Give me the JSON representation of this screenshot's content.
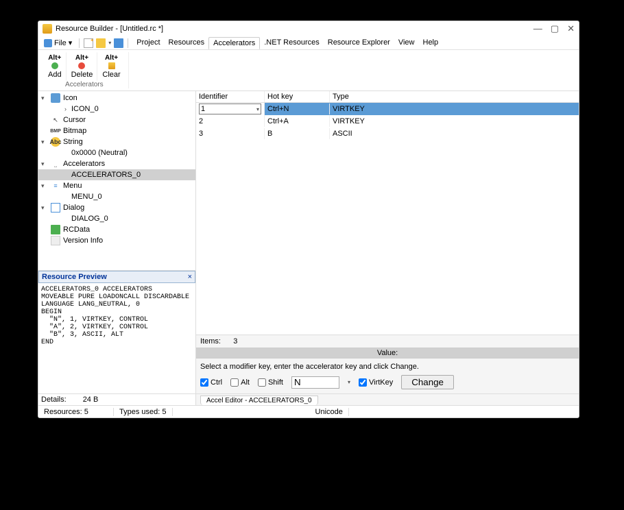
{
  "title": "Resource Builder - [Untitled.rc *]",
  "windowControls": {
    "min": "—",
    "max": "▢",
    "close": "✕"
  },
  "file": {
    "label": "File",
    "arrow": "▾"
  },
  "topMenu": [
    "Project",
    "Resources",
    "Accelerators",
    ".NET Resources",
    "Resource Explorer",
    "View",
    "Help"
  ],
  "activeTopMenuIndex": 2,
  "ribbon": {
    "group": "Accelerators",
    "buttons": [
      {
        "keycap": "Alt+",
        "label": "Add"
      },
      {
        "keycap": "Alt+",
        "label": "Delete"
      },
      {
        "keycap": "Alt+",
        "label": "Clear"
      }
    ]
  },
  "tree": [
    {
      "expander": "▾",
      "icon": "icon",
      "label": "Icon"
    },
    {
      "child": true,
      "expander": "›",
      "label": "ICON_0"
    },
    {
      "icon": "cursor",
      "glyph": "↖",
      "label": "Cursor"
    },
    {
      "icon": "bmp",
      "glyph": "BMP",
      "label": "Bitmap"
    },
    {
      "expander": "▾",
      "icon": "string",
      "glyph": "Abc",
      "label": "String"
    },
    {
      "child": true,
      "label": "0x0000 (Neutral)"
    },
    {
      "expander": "▾",
      "icon": "accel",
      "glyph": "⎵",
      "label": "Accelerators"
    },
    {
      "child": true,
      "selected": true,
      "label": "ACCELERATORS_0"
    },
    {
      "expander": "▾",
      "icon": "menu",
      "glyph": "≡",
      "label": "Menu"
    },
    {
      "child": true,
      "label": "MENU_0"
    },
    {
      "expander": "▾",
      "icon": "dialog",
      "label": "Dialog"
    },
    {
      "child": true,
      "label": "DIALOG_0"
    },
    {
      "icon": "rcdata",
      "glyph": "",
      "label": "RCData"
    },
    {
      "icon": "ver",
      "glyph": "",
      "label": "Version Info"
    }
  ],
  "preview": {
    "title": "Resource Preview",
    "body": "ACCELERATORS_0 ACCELERATORS\nMOVEABLE PURE LOADONCALL DISCARDABLE\nLANGUAGE LANG_NEUTRAL, 0\nBEGIN\n  \"N\", 1, VIRTKEY, CONTROL\n  \"A\", 2, VIRTKEY, CONTROL\n  \"B\", 3, ASCII, ALT\nEND"
  },
  "details": {
    "label": "Details:",
    "value": "24 B"
  },
  "columns": {
    "id": "Identifier",
    "hk": "Hot key",
    "type": "Type"
  },
  "rows": [
    {
      "id": "1",
      "hk": "Ctrl+N",
      "type": "VIRTKEY",
      "editing": true
    },
    {
      "id": "2",
      "hk": "Ctrl+A",
      "type": "VIRTKEY"
    },
    {
      "id": "3",
      "hk": "B",
      "type": "ASCII"
    }
  ],
  "items": {
    "label": "Items:",
    "count": "3"
  },
  "valueHeader": "Value:",
  "editor": {
    "hint": "Select a modifier key, enter the accelerator key and click Change.",
    "ctrl": {
      "label": "Ctrl",
      "checked": true
    },
    "alt": {
      "label": "Alt",
      "checked": false
    },
    "shift": {
      "label": "Shift",
      "checked": false
    },
    "keyValue": "N",
    "virtkey": {
      "label": "VirtKey",
      "checked": true
    },
    "changeLabel": "Change"
  },
  "tab": "Accel Editor - ACCELERATORS_0",
  "status": {
    "resources": {
      "label": "Resources:",
      "value": "5"
    },
    "types": {
      "label": "Types used:",
      "value": "5"
    },
    "unicode": "Unicode"
  }
}
